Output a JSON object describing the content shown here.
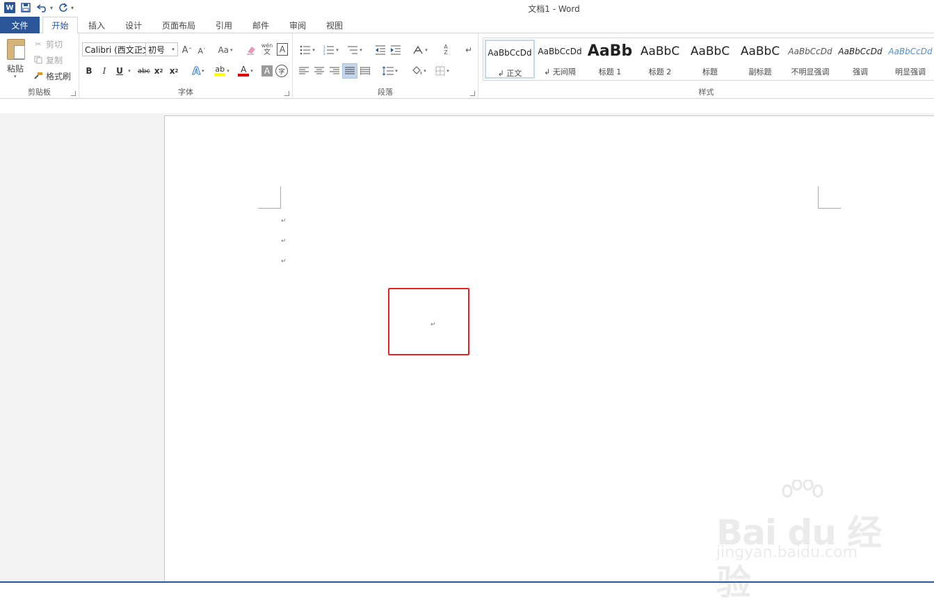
{
  "window": {
    "title": "文档1 - Word"
  },
  "qat": {
    "save_icon": "save-icon",
    "undo_icon": "undo-icon",
    "redo_icon": "redo-icon"
  },
  "tabs": {
    "file": "文件",
    "items": [
      "开始",
      "插入",
      "设计",
      "页面布局",
      "引用",
      "邮件",
      "审阅",
      "视图"
    ],
    "active": "开始"
  },
  "clipboard": {
    "paste_label": "粘贴",
    "cut_label": "剪切",
    "copy_label": "复制",
    "format_painter_label": "格式刷",
    "group_label": "剪贴板"
  },
  "font": {
    "font_name": "Calibri (西文正文",
    "font_size": "初号",
    "group_label": "字体",
    "grow_glyph": "A",
    "shrink_glyph": "A",
    "case_glyph": "Aa",
    "phonetic_top": "wén",
    "phonetic_bottom": "文",
    "bold": "B",
    "italic": "I",
    "underline": "U",
    "strike": "abc",
    "subscript": "x",
    "superscript": "x",
    "sub_mark": "2",
    "sup_mark": "2",
    "char_shading": "A",
    "enclose": "字",
    "highlight_color": "#ffff00",
    "font_color": "#e00000"
  },
  "paragraph": {
    "group_label": "段落"
  },
  "styles": {
    "group_label": "样式",
    "items": [
      {
        "sample": "AaBbCcDd",
        "name": "正文"
      },
      {
        "sample": "AaBbCcDd",
        "name": "无间隔"
      },
      {
        "sample": "AaBb",
        "name": "标题 1"
      },
      {
        "sample": "AaBbC",
        "name": "标题 2"
      },
      {
        "sample": "AaBbC",
        "name": "标题"
      },
      {
        "sample": "AaBbC",
        "name": "副标题"
      },
      {
        "sample": "AaBbCcDd",
        "name": "不明显强调"
      },
      {
        "sample": "AaBbCcDd",
        "name": "强调"
      },
      {
        "sample": "AaBbCcDd",
        "name": "明显强调"
      }
    ],
    "paragraph_mark": "↲"
  },
  "document": {
    "paragraph_mark": "↵",
    "highlight_color": "#e4251e"
  },
  "watermark": {
    "brand": "Bai du 经验",
    "url": "jingyan.baidu.com"
  },
  "colors": {
    "accent": "#2b579a"
  }
}
